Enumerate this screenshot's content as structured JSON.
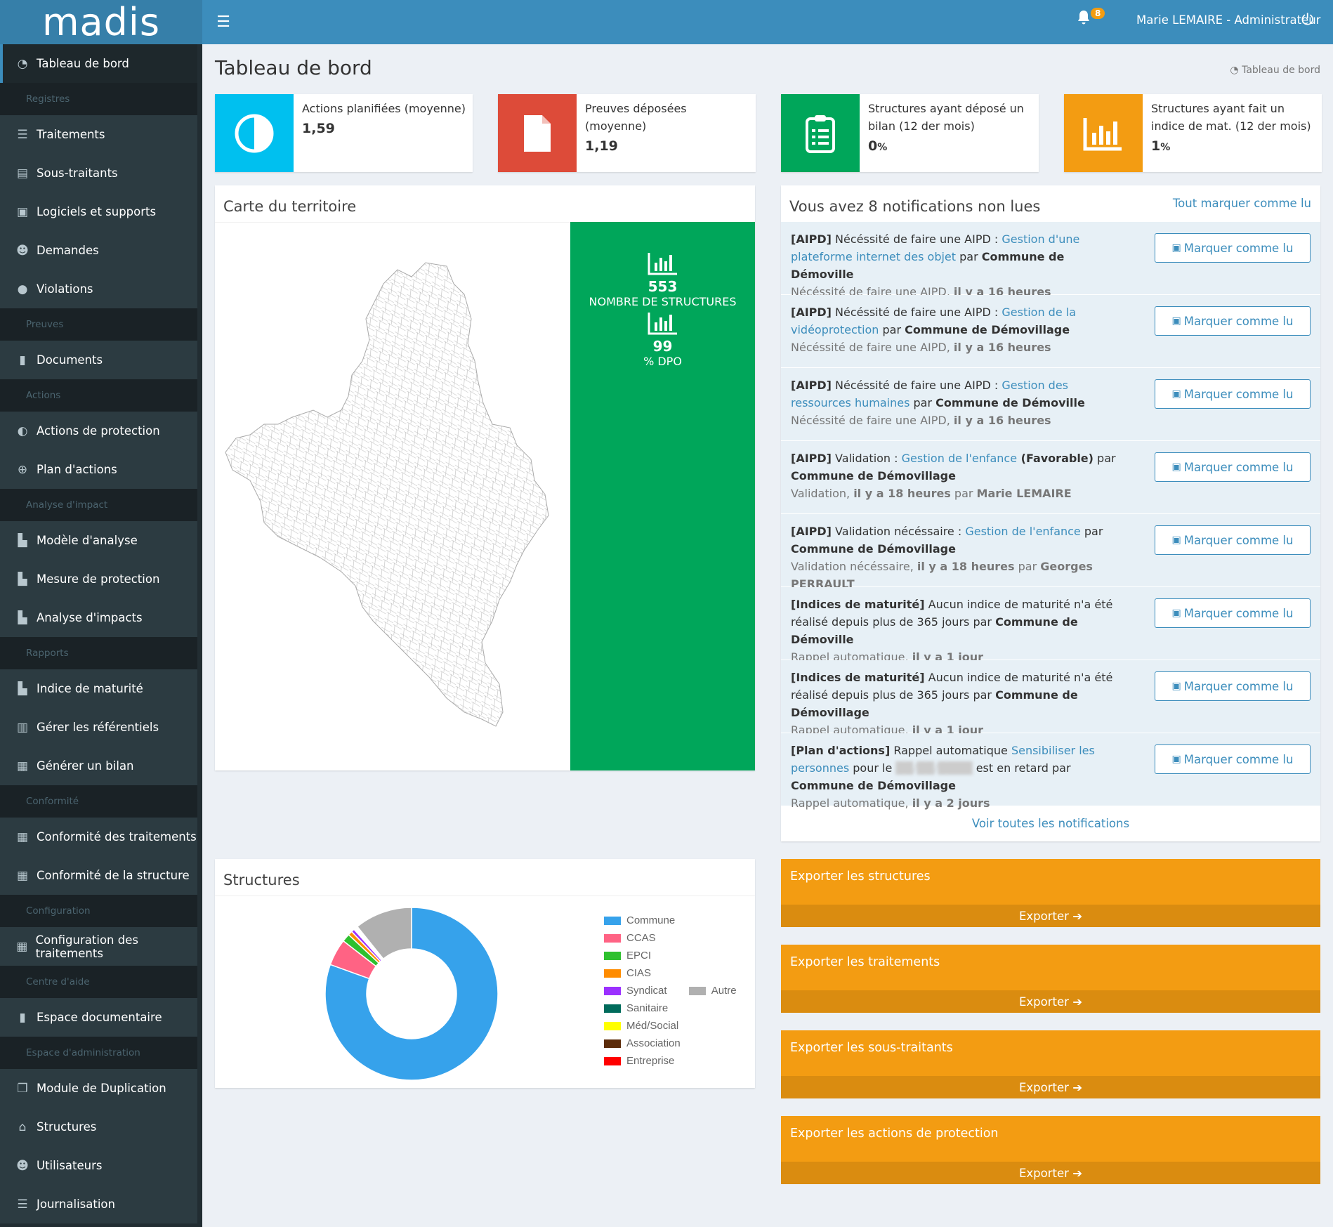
{
  "app": {
    "logo_text": "madis",
    "user_label": "Marie LEMAIRE - Administrateur",
    "notif_count": "8"
  },
  "sidebar": {
    "dashboard": "Tableau de bord",
    "h_registres": "Registres",
    "traitements": "Traitements",
    "sous_traitants": "Sous-traitants",
    "logiciels": "Logiciels et supports",
    "demandes": "Demandes",
    "violations": "Violations",
    "h_preuves": "Preuves",
    "documents": "Documents",
    "h_actions": "Actions",
    "actions_protection": "Actions de protection",
    "plan_actions": "Plan d'actions",
    "h_analyse": "Analyse d'impact",
    "modele_analyse": "Modèle d'analyse",
    "mesure_protection": "Mesure de protection",
    "analyse_impacts": "Analyse d'impacts",
    "h_rapports": "Rapports",
    "indice_maturite": "Indice de maturité",
    "referentiels": "Gérer les référentiels",
    "bilan": "Générer un bilan",
    "h_conformite": "Conformité",
    "conf_traitements": "Conformité des traitements",
    "conf_structure": "Conformité de la structure",
    "h_config": "Configuration",
    "config_traitements": "Configuration des traitements",
    "h_aide": "Centre d'aide",
    "espace_doc": "Espace documentaire",
    "h_admin": "Espace d'administration",
    "duplication": "Module de Duplication",
    "structures": "Structures",
    "utilisateurs": "Utilisateurs",
    "journalisation": "Journalisation"
  },
  "page": {
    "title": "Tableau de bord",
    "breadcrumb": "Tableau de bord"
  },
  "kpis": [
    {
      "label": "Actions planifiées (moyenne)",
      "value": "1,59",
      "color": "#00c0ef",
      "icon": "half-circle-icon"
    },
    {
      "label": "Preuves déposées (moyenne)",
      "value": "1,19",
      "color": "#dd4b39",
      "icon": "file-icon"
    },
    {
      "label": "Structures ayant déposé un bilan (12 der mois)",
      "value": "0",
      "unit": "%",
      "color": "#00a65a",
      "icon": "clipboard-list-icon"
    },
    {
      "label": "Structures ayant fait un indice de mat. (12 der mois)",
      "value": "1",
      "unit": "%",
      "color": "#f39c12",
      "icon": "bar-chart-icon"
    }
  ],
  "map": {
    "title": "Carte du territoire",
    "stat1_value": "553",
    "stat1_label": "NOMBRE DE STRUCTURES",
    "stat2_value": "99",
    "stat2_label": "% DPO"
  },
  "notifications": {
    "title": "Vous avez 8 notifications non lues",
    "mark_all": "Tout marquer comme lu",
    "mark_btn": "Marquer comme lu",
    "see_all": "Voir toutes les notifications",
    "items": [
      {
        "tag": "[AIPD]",
        "pre": " Nécéssité de faire une AIPD : ",
        "link": "Gestion d'une plateforme internet des objet",
        "mid": " par ",
        "org": "Commune de Démoville",
        "sub1": "Nécéssité de faire une AIPD, ",
        "sub2": "il y a 16 heures",
        "sub3": "",
        "sub4": ""
      },
      {
        "tag": "[AIPD]",
        "pre": " Nécéssité de faire une AIPD : ",
        "link": "Gestion de la vidéoprotection",
        "mid": " par ",
        "org": "Commune de Démovillage",
        "sub1": "Nécéssité de faire une AIPD, ",
        "sub2": "il y a 16 heures",
        "sub3": "",
        "sub4": ""
      },
      {
        "tag": "[AIPD]",
        "pre": " Nécéssité de faire une AIPD : ",
        "link": "Gestion des ressources humaines",
        "mid": " par ",
        "org": "Commune de Démoville",
        "sub1": "Nécéssité de faire une AIPD, ",
        "sub2": "il y a 16 heures",
        "sub3": "",
        "sub4": ""
      },
      {
        "tag": "[AIPD]",
        "pre": " Validation : ",
        "link": "Gestion de l'enfance",
        "mid2": " (Favorable)",
        "mid": " par ",
        "org": "Commune de Démovillage",
        "sub1": "Validation, ",
        "sub2": "il y a 18 heures",
        "sub3": " par ",
        "sub4": "Marie LEMAIRE"
      },
      {
        "tag": "[AIPD]",
        "pre": " Validation nécéssaire : ",
        "link": "Gestion de l'enfance",
        "mid": " par ",
        "org": "Commune de Démovillage",
        "sub1": "Validation nécéssaire, ",
        "sub2": "il y a 18 heures",
        "sub3": " par ",
        "sub4": "Georges PERRAULT"
      },
      {
        "tag": "[Indices de maturité]",
        "pre": " Aucun indice de maturité n'a été réalisé depuis plus de 365 jours",
        "link": "",
        "mid": " par ",
        "org": "Commune de Démoville",
        "sub1": "Rappel automatique, ",
        "sub2": "il y a 1 jour",
        "sub3": "",
        "sub4": ""
      },
      {
        "tag": "[Indices de maturité]",
        "pre": " Aucun indice de maturité n'a été réalisé depuis plus de 365 jours",
        "link": "",
        "mid": " par ",
        "org": "Commune de Démovillage",
        "sub1": "Rappel automatique, ",
        "sub2": "il y a 1 jour",
        "sub3": "",
        "sub4": ""
      },
      {
        "tag": "[Plan d'actions]",
        "pre": " Rappel automatique ",
        "link": "Sensibiliser les personnes",
        "mid": " pour le ",
        "blur": "██/██/████",
        "mid3": " est en retard par ",
        "org": "Commune de Démovillage",
        "sub1": "Rappel automatique, ",
        "sub2": "il y a 2 jours",
        "sub3": "",
        "sub4": ""
      }
    ]
  },
  "structures_chart": {
    "title": "Structures",
    "chart_data": {
      "type": "pie",
      "labels": [
        "Commune",
        "CCAS",
        "EPCI",
        "CIAS",
        "Syndicat",
        "Sanitaire",
        "Méd/Social",
        "Association",
        "Entreprise",
        "Autre"
      ],
      "values": [
        80.5,
        5,
        1.5,
        0.8,
        0.6,
        0.2,
        0.2,
        0.2,
        0.2,
        10.8
      ],
      "colors": [
        "#36a2eb",
        "#ff6384",
        "#2ec02e",
        "#ff8c00",
        "#9b30ff",
        "#006b5b",
        "#ffff00",
        "#5c2c0a",
        "#ff0000",
        "#b0b0b0"
      ]
    }
  },
  "exports": [
    {
      "title": "Exporter les structures",
      "btn": "Exporter"
    },
    {
      "title": "Exporter les traitements",
      "btn": "Exporter"
    },
    {
      "title": "Exporter les sous-traitants",
      "btn": "Exporter"
    },
    {
      "title": "Exporter les actions de protection",
      "btn": "Exporter"
    }
  ]
}
